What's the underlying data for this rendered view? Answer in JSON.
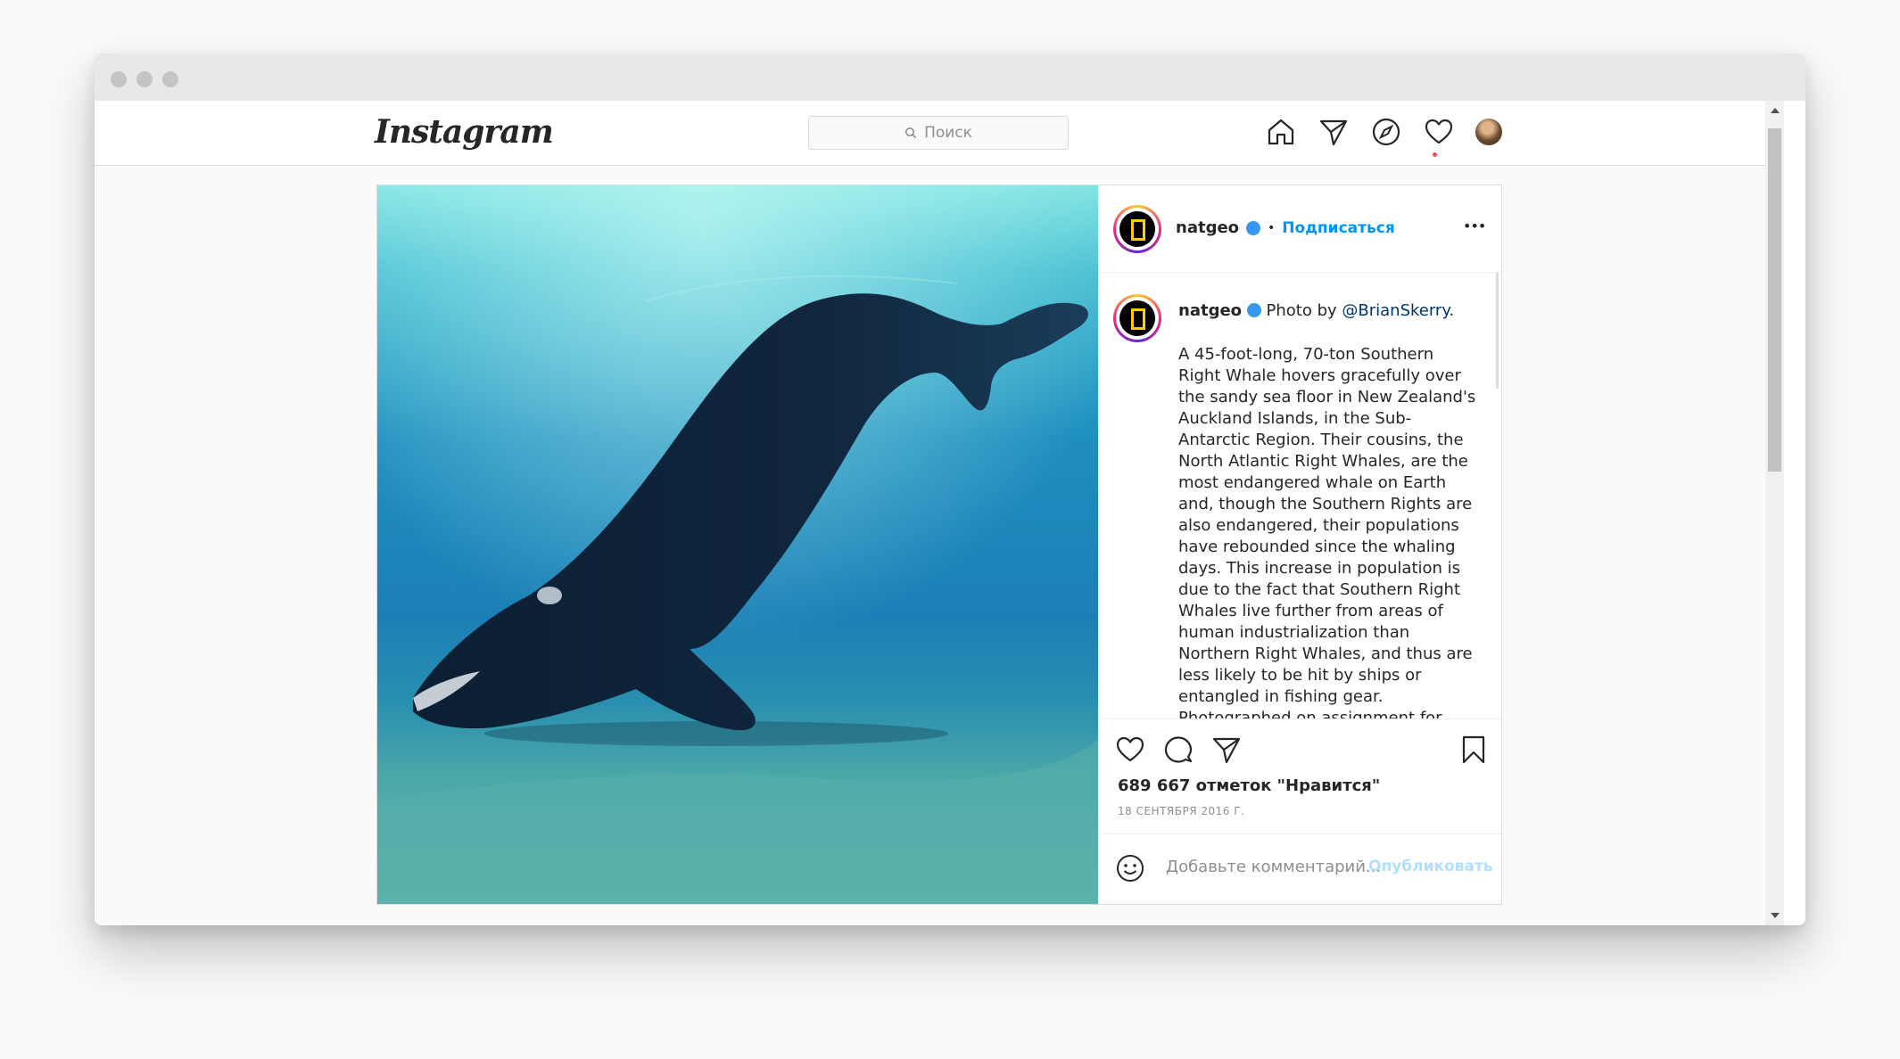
{
  "nav": {
    "logo_text": "Instagram",
    "search_placeholder": "Поиск",
    "icons": [
      "home-icon",
      "direct-icon",
      "explore-icon",
      "activity-heart-icon",
      "profile-avatar"
    ]
  },
  "post": {
    "header": {
      "username": "natgeo",
      "separator": "•",
      "follow_label": "Подписаться",
      "more_label": "•••"
    },
    "caption": {
      "username": "natgeo",
      "intro": "Photo by ",
      "mention": "@BrianSkerry",
      "intro_end": ".",
      "body": "A 45-foot-long, 70-ton Southern Right Whale hovers gracefully over the sandy sea floor in New Zealand's Auckland Islands, in the Sub-Antarctic Region. Their cousins, the North Atlantic Right Whales, are the most endangered whale on Earth and, though the Southern Rights are also endangered, their populations have rebounded since the whaling days. This increase in population is due to the fact that Southern Right Whales live further from areas of human industrialization than Northern Right Whales, and thus are less likely to be hit by ships or entangled in fishing gear.",
      "body_cut": "Photographed on assignment for"
    },
    "likes": "689 667 отметок \"Нравится\"",
    "date": "18 СЕНТЯБРЯ 2016 Г.",
    "comment_placeholder": "Добавьте комментарий...",
    "publish_label": "Опубликовать"
  },
  "colors": {
    "link_blue": "#0095f6",
    "mention_blue": "#00376b",
    "publish_disabled": "#b2dffc",
    "notification_dot": "#ed4956"
  }
}
